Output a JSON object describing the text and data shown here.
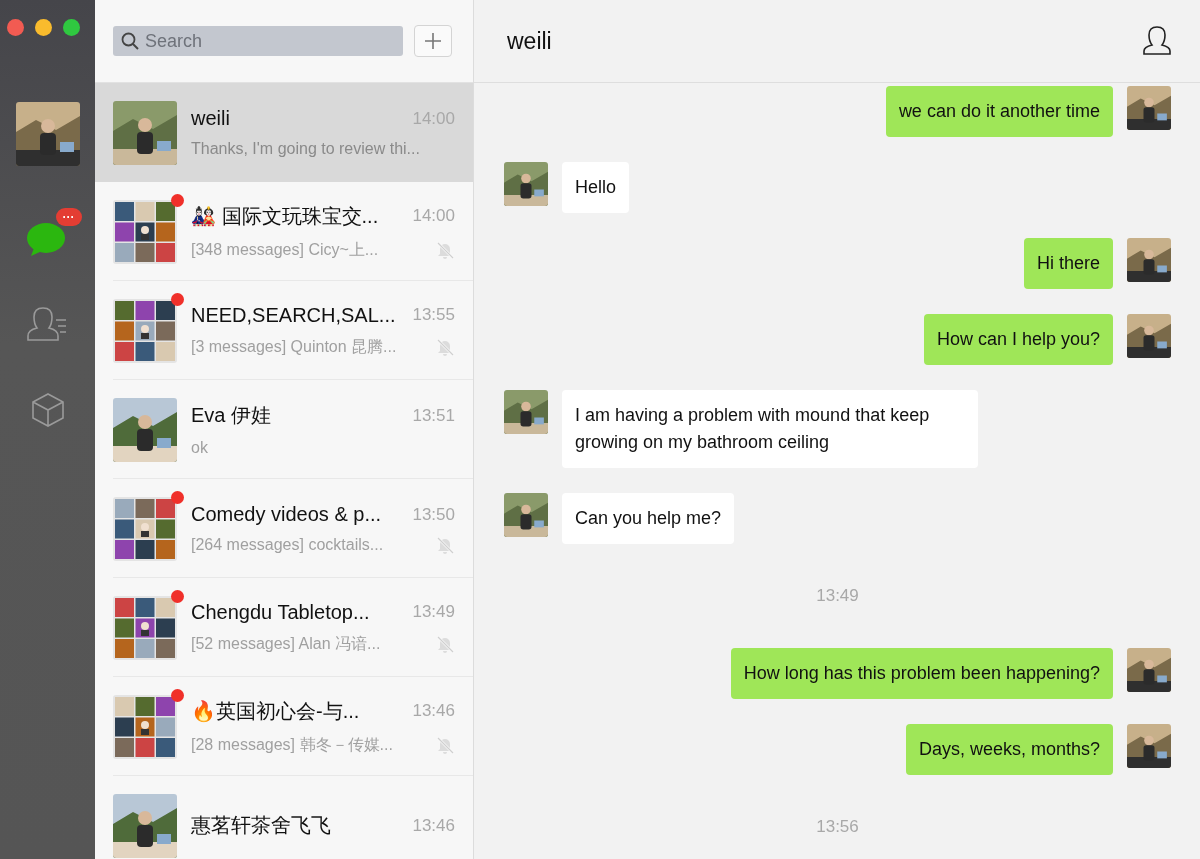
{
  "sidebar": {
    "badge": "···",
    "items": [
      {
        "kind": "chats",
        "selected": true
      },
      {
        "kind": "contacts",
        "selected": false
      },
      {
        "kind": "favorites",
        "selected": false
      }
    ]
  },
  "chat_list": {
    "search": {
      "placeholder": "Search"
    },
    "chats": [
      {
        "kind": "direct",
        "name": "weili",
        "time": "14:00",
        "preview": "Thanks, I'm going to review thi...",
        "selected": true,
        "unread": false,
        "muted": false
      },
      {
        "kind": "group",
        "name": "🎎 国际文玩珠宝交...",
        "time": "14:00",
        "preview": "[348 messages] Cicy~上...",
        "selected": false,
        "unread": true,
        "muted": true
      },
      {
        "kind": "group",
        "name": "NEED,SEARCH,SAL...",
        "time": "13:55",
        "preview": "[3 messages] Quinton 昆腾...",
        "selected": false,
        "unread": true,
        "muted": true
      },
      {
        "kind": "direct",
        "name": "Eva 伊娃",
        "time": "13:51",
        "preview": "ok",
        "selected": false,
        "unread": false,
        "muted": false
      },
      {
        "kind": "group",
        "name": "Comedy videos & p...",
        "time": "13:50",
        "preview": "[264 messages] cocktails...",
        "selected": false,
        "unread": true,
        "muted": true
      },
      {
        "kind": "group",
        "name": "Chengdu Tabletop...",
        "time": "13:49",
        "preview": "[52 messages] Alan  冯谙...",
        "selected": false,
        "unread": true,
        "muted": true
      },
      {
        "kind": "group",
        "name": "🔥英国初心会-与...",
        "time": "13:46",
        "preview": "[28 messages] 韩冬－传媒...",
        "selected": false,
        "unread": true,
        "muted": true
      },
      {
        "kind": "direct",
        "name": "惠茗轩茶舍飞飞",
        "time": "13:46",
        "selected": false,
        "unread": false,
        "muted": false
      }
    ]
  },
  "conversation": {
    "title": "weili",
    "messages": [
      {
        "kind": "sent",
        "text": "we can do it another time"
      },
      {
        "kind": "received",
        "text": "Hello"
      },
      {
        "kind": "sent",
        "text": "Hi there"
      },
      {
        "kind": "sent",
        "text": "How can I help you?"
      },
      {
        "kind": "received",
        "text": "I am having a problem with mound that keep growing on my bathroom ceiling"
      },
      {
        "kind": "received",
        "text": "Can you help me?"
      },
      {
        "kind": "time",
        "text": "13:49"
      },
      {
        "kind": "sent",
        "text": "How long has this problem been happening?"
      },
      {
        "kind": "sent",
        "text": "Days, weeks, months?"
      },
      {
        "kind": "time",
        "text": "13:56"
      }
    ]
  }
}
